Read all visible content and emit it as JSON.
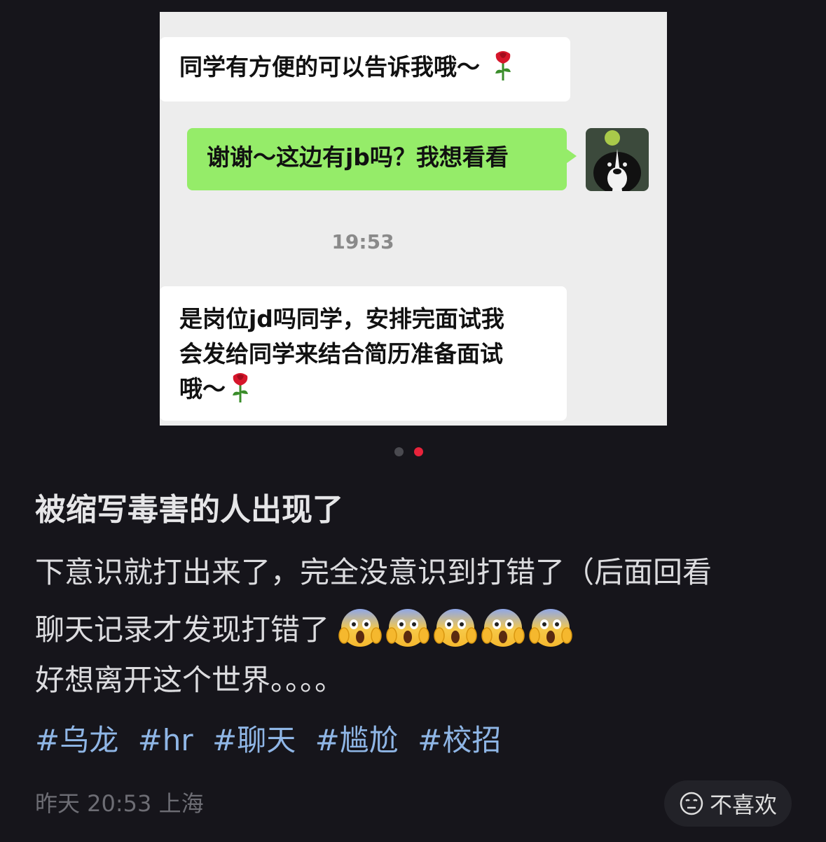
{
  "chat": {
    "msg1": "同学有方便的可以告诉我哦～",
    "msg2": "谢谢～这边有jb吗？我想看看",
    "time": "19:53",
    "msg3_line1": "是岗位jd吗同学，安排完面试我",
    "msg3_line2": "会发给同学来结合简历准备面试",
    "msg3_line3": "哦～"
  },
  "post": {
    "title": "被缩写毒害的人出现了",
    "line1": "下意识就打出来了，完全没意识到打错了（后面回看",
    "line2": "聊天记录才发现打错了",
    "line3": "好想离开这个世界。。。。",
    "tags": [
      "#乌龙",
      "#hr",
      "#聊天",
      "#尴尬",
      "#校招"
    ],
    "meta": "昨天 20:53 上海",
    "dislike_label": "不喜欢"
  },
  "carousel": {
    "total": 2,
    "active_index": 1
  },
  "colors": {
    "bg": "#16151b",
    "bubble_out": "#95ec69",
    "tag": "#8fb6e6",
    "active_dot": "#e8233b"
  },
  "icons": {
    "emoji": "face-screaming-in-fear",
    "rose": "rose-icon",
    "dislike": "neutral-face-icon"
  }
}
